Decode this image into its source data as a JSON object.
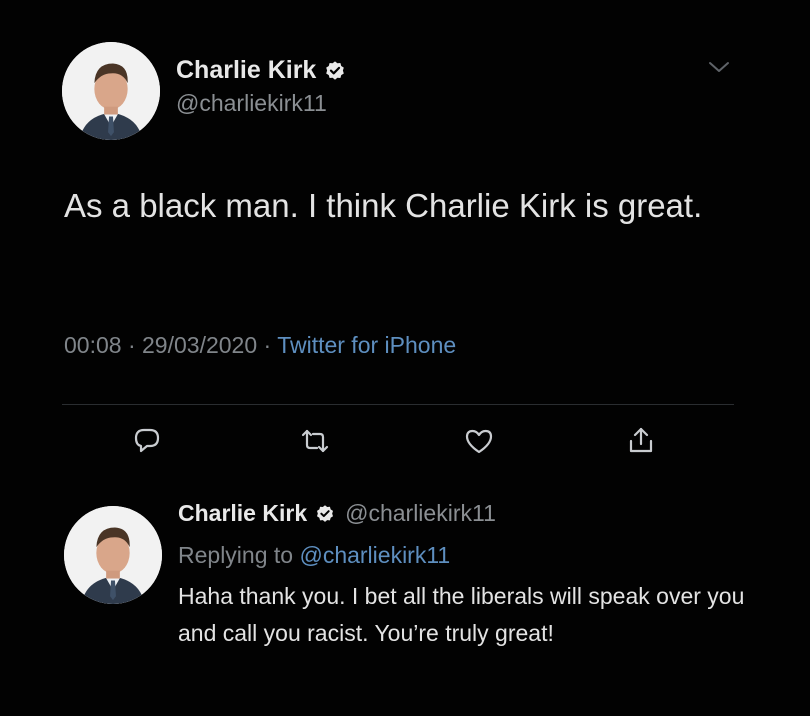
{
  "colors": {
    "background": "#000000",
    "text": "#e3e3e3",
    "muted": "#80858a",
    "link": "#5e8fc0",
    "verified": "#e9e9e9"
  },
  "tweet": {
    "author_name": "Charlie Kirk",
    "author_handle": "@charliekirk11",
    "verified": true,
    "text": "As a black man. I think Charlie Kirk is great.",
    "time": "00:08",
    "separator": "·",
    "date": "29/03/2020",
    "source": "Twitter for iPhone",
    "icons": {
      "verified": "verified-badge-icon",
      "more": "chevron-down-icon"
    },
    "actions": [
      {
        "name": "reply",
        "icon": "reply-icon"
      },
      {
        "name": "retweet",
        "icon": "retweet-icon"
      },
      {
        "name": "like",
        "icon": "heart-icon"
      },
      {
        "name": "share",
        "icon": "share-icon"
      }
    ]
  },
  "reply": {
    "author_name": "Charlie Kirk",
    "author_handle": "@charliekirk11",
    "verified": true,
    "replying_to_label": "Replying to",
    "replying_to_handle": "@charliekirk11",
    "text": "Haha thank you. I bet all the liberals will speak over you and call you racist. You’re truly great!"
  }
}
